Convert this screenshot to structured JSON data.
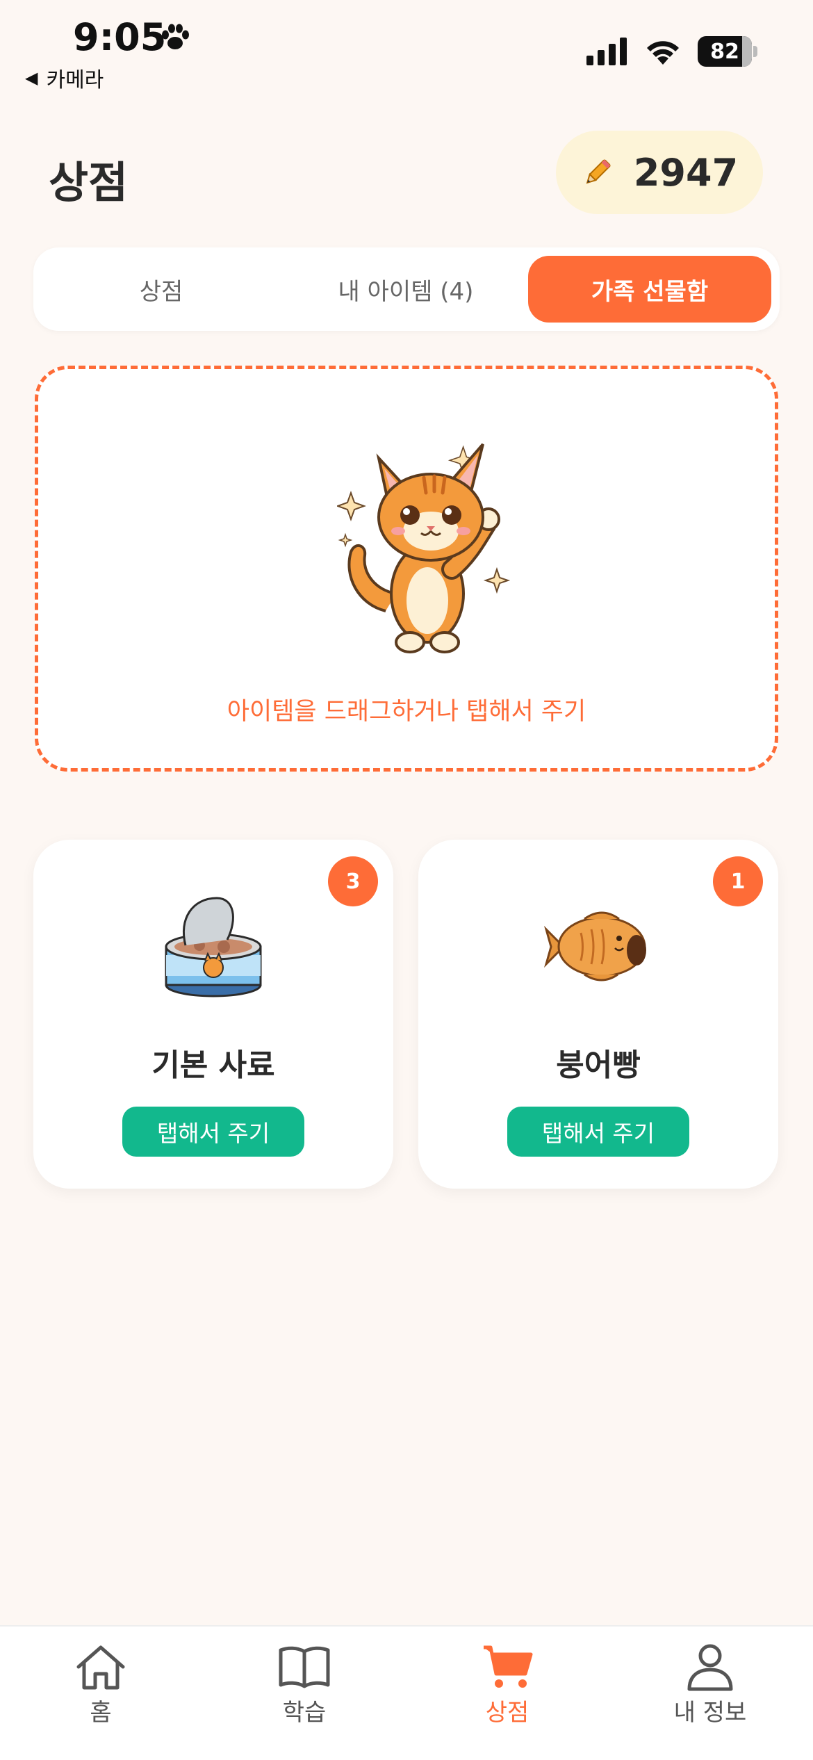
{
  "status_bar": {
    "time": "9:05",
    "back_app": "카메라",
    "battery": "82",
    "icons": [
      "paw-icon",
      "signal-icon",
      "wifi-icon",
      "battery-icon"
    ]
  },
  "header": {
    "title": "상점",
    "points": "2947",
    "points_icon": "pencil-icon"
  },
  "tabs": [
    {
      "label": "상점",
      "active": false
    },
    {
      "label": "내 아이템 (4)",
      "active": false
    },
    {
      "label": "가족 선물함",
      "active": true
    }
  ],
  "dropzone": {
    "image": "cat-waving-illustration",
    "hint": "아이템을 드래그하거나 탭해서 주기"
  },
  "items": [
    {
      "name": "기본 사료",
      "count": "3",
      "button": "탭해서 주기",
      "image": "cat-food-can-icon"
    },
    {
      "name": "붕어빵",
      "count": "1",
      "button": "탭해서 주기",
      "image": "fish-bread-icon"
    }
  ],
  "bottom_nav": [
    {
      "label": "홈",
      "icon": "home-icon",
      "active": false
    },
    {
      "label": "학습",
      "icon": "book-icon",
      "active": false
    },
    {
      "label": "상점",
      "icon": "cart-icon",
      "active": true
    },
    {
      "label": "내 정보",
      "icon": "user-icon",
      "active": false
    }
  ],
  "colors": {
    "accent": "#fe6c37",
    "give_button": "#12b88d",
    "background": "#fdf7f3",
    "points_bg": "#fdf4d8"
  }
}
